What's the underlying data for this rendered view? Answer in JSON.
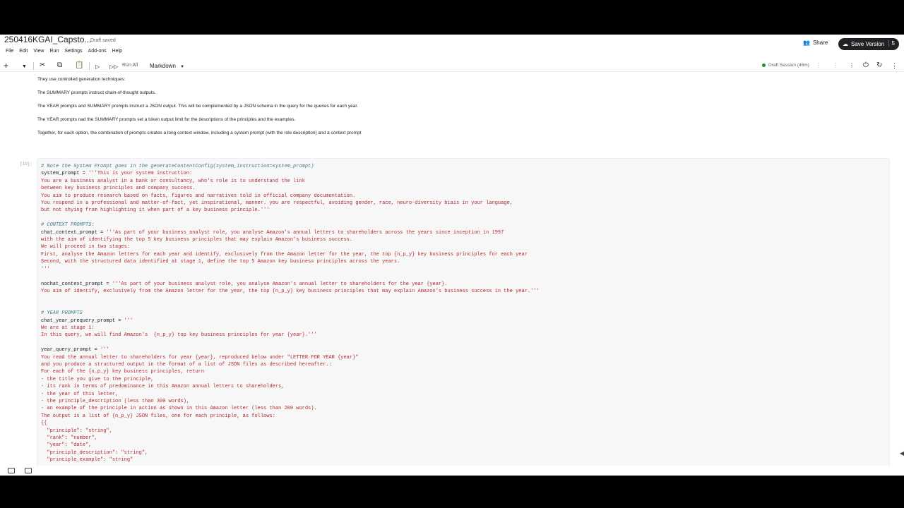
{
  "notebook": {
    "title": "250416KGAI_Capsto...",
    "status": "Draft saved"
  },
  "header": {
    "share_label": "Share",
    "save_version_label": "Save Version",
    "version_count": "5"
  },
  "menu": [
    "File",
    "Edit",
    "View",
    "Run",
    "Settings",
    "Add-ons",
    "Help"
  ],
  "toolbar": {
    "run_all_label": "Run All",
    "cell_type": "Markdown",
    "session_label": "Draft Session (46m)"
  },
  "markdown_lines": [
    "They use controlled generation techniques:",
    "The SUMMARY prompts instruct chain-of-thought outputs.",
    "The YEAR prompts and SUMMARY prompts instruct a JSON output. This will be complemented by a JSON schema in the query for the queries for each year.",
    "The YEAR prompts nad the SUMMARY prompts set a token output limit for the descriptions of the principles and the examples.",
    "Together, for each option, the combination of prompts creates a long context window, including a system prompt (with the role description) and a context prompt"
  ],
  "cell": {
    "execution_label": "[10]:",
    "code_lines": [
      "# Note the System Prompt goes in the generateContentConfig(system_instruction=system_prompt)",
      "system_prompt = '''This is your system instruction:",
      "You are a business analyst in a bank or consultancy, who's role is to understand the link",
      "between key business principles and company success.",
      "You aim to produce research based on facts, figures and narratives told in official company documentation.",
      "You respond in a professional and matter-of-fact, yet inspirational, manner. you are respectful, avoiding gender, race, neuro-diversity biais in your language,",
      "but not shying from highlighting it when part of a key business principle.'''",
      "",
      "# CONTEXT PROMPTS:",
      "chat_context_prompt = '''As part of your business analyst role, you analyse Amazon's annual letters to shareholders across the years since inception in 1997",
      "with the aim of identifying the top 5 key business principles that may explain Amazon's business success.",
      "We will proceed in two stages:",
      "First, analyse the Amazon letters for each year and identify, exclusively from the Amazon letter for the year, the top {n_p_y} key business principles for each year",
      "Second, with the structured data identified at stage 1, define the top 5 Amazon key business principles across the years.",
      "'''",
      "",
      "nochat_context_prompt = '''As part of your business analyst role, you analyse Amazon's annual letter to shareholders for the year {year}.",
      "You aim of identify, exclusively from the Amazon letter for the year, the top {n_p_y} key business principles that may explain Amazon's business success in the year.'''",
      "",
      "",
      "# YEAR PROMPTS",
      "chat_year_prequery_prompt = '''",
      "We are at stage 1:",
      "In this query, we will find Amazon's  {n_p_y} top key business principles for year {year}.'''",
      "",
      "year_query_prompt = '''",
      "You read the annual letter to shareholders for year {year}, reproduced below under \"LETTER FOR YEAR {year}\"",
      "and you produce a structured output in the format of a list of JSON files as described hereafter.:",
      "For each of the {n_p_y} key business principles, return",
      "- the title you give to the principle,",
      "- its rank in terms of predominance in this Amazon annual letters to shareholders,",
      "- the year of this letter,",
      "- the principle_description (less than 300 words),",
      "- an example of the principle in action as shown in this Amazon letter (less than 200 words).",
      "The output is a list of {n_p_y} JSON files, one for each principle, as follows:",
      "{{",
      "  \"principle\": \"string\",",
      "  \"rank\": \"number\",",
      "  \"year\": \"date\",",
      "  \"principle_description\": \"string\",",
      "  \"principle_example\": \"string\""
    ]
  }
}
